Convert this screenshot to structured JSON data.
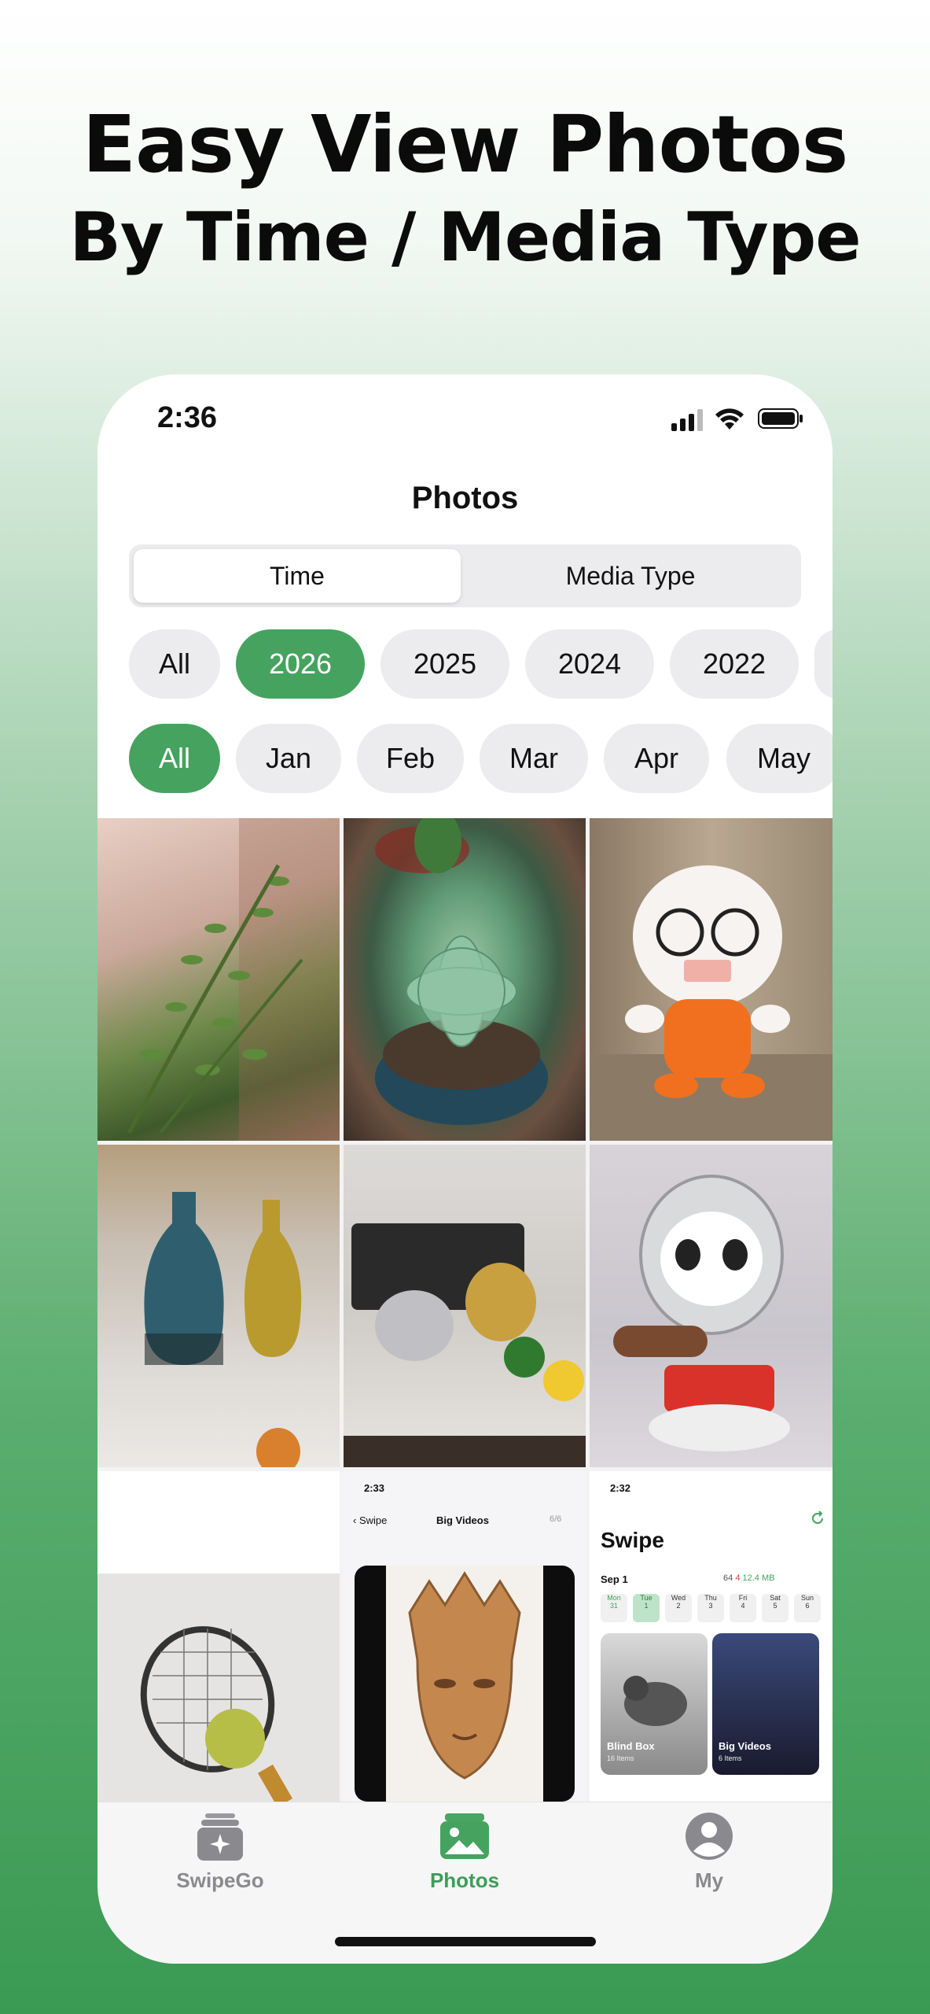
{
  "headline": {
    "line1": "Easy View Photos",
    "line2": "By Time / Media Type"
  },
  "status_bar": {
    "time": "2:36",
    "icons": [
      "signal-icon",
      "wifi-icon",
      "battery-icon"
    ]
  },
  "nav": {
    "title": "Photos"
  },
  "segmented_control": {
    "options": [
      "Time",
      "Media Type"
    ],
    "selected": "Time"
  },
  "year_filters": {
    "items": [
      "All",
      "2026",
      "2025",
      "2024",
      "2022"
    ],
    "selected": "2026"
  },
  "month_filters": {
    "items": [
      "All",
      "Jan",
      "Feb",
      "Mar",
      "Apr",
      "May"
    ],
    "selected": "All"
  },
  "photo_grid": {
    "items": [
      {
        "subject": "succulent plant by window"
      },
      {
        "subject": "potted succulent"
      },
      {
        "subject": "plush toy in orange shirt"
      },
      {
        "subject": "two glazed vases"
      },
      {
        "subject": "elephant and camel figurines"
      },
      {
        "subject": "panda mascot figure"
      },
      {
        "subject": "tennis racket"
      },
      {
        "subject": "app screenshot - Big Videos"
      },
      {
        "subject": "app screenshot - Swipe"
      }
    ],
    "screenshot_big_videos": {
      "time": "2:33",
      "back": "Swipe",
      "title": "Big Videos",
      "counter": "6/6"
    },
    "screenshot_swipe": {
      "time": "2:32",
      "title": "Swipe",
      "date": "Sep 1",
      "stats": [
        "64",
        "4",
        "12.4 MB"
      ],
      "days": [
        {
          "dow": "Mon",
          "day": "31"
        },
        {
          "dow": "Tue",
          "day": "1"
        },
        {
          "dow": "Wed",
          "day": "2"
        },
        {
          "dow": "Thu",
          "day": "3"
        },
        {
          "dow": "Fri",
          "day": "4"
        },
        {
          "dow": "Sat",
          "day": "5"
        },
        {
          "dow": "Sun",
          "day": "6"
        }
      ],
      "cards": [
        {
          "title": "Blind Box",
          "sub": "16 Items"
        },
        {
          "title": "Big Videos",
          "sub": "6 Items"
        }
      ]
    }
  },
  "tab_bar": {
    "tabs": [
      {
        "label": "SwipeGo",
        "icon": "cards-sparkle-icon"
      },
      {
        "label": "Photos",
        "icon": "photos-icon"
      },
      {
        "label": "My",
        "icon": "person-icon"
      }
    ],
    "selected": "Photos"
  },
  "colors": {
    "accent": "#45a35f",
    "chip_bg": "#ececee",
    "tab_inactive": "#8a8a8e"
  }
}
